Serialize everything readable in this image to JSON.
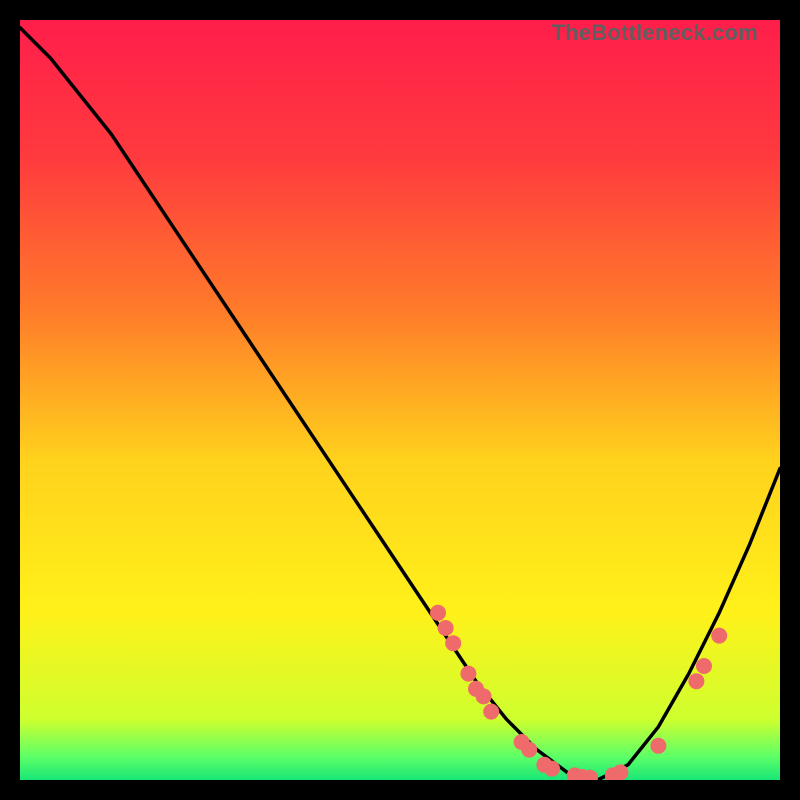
{
  "attribution": "TheBottleneck.com",
  "chart_data": {
    "type": "line",
    "title": "",
    "xlabel": "",
    "ylabel": "",
    "xlim": [
      0,
      100
    ],
    "ylim": [
      0,
      100
    ],
    "gradient_stops": [
      {
        "offset": 0,
        "color": "#ff1e4b"
      },
      {
        "offset": 18,
        "color": "#ff3a3e"
      },
      {
        "offset": 38,
        "color": "#ff7a2a"
      },
      {
        "offset": 58,
        "color": "#ffd21c"
      },
      {
        "offset": 78,
        "color": "#fff11a"
      },
      {
        "offset": 92,
        "color": "#ceff2e"
      },
      {
        "offset": 97,
        "color": "#5bff68"
      },
      {
        "offset": 100,
        "color": "#19e676"
      }
    ],
    "series": [
      {
        "name": "bottleneck-curve",
        "x": [
          0,
          4,
          8,
          12,
          16,
          20,
          24,
          28,
          32,
          36,
          40,
          44,
          48,
          52,
          56,
          60,
          64,
          68,
          72,
          76,
          80,
          84,
          88,
          92,
          96,
          100
        ],
        "y": [
          99,
          95,
          90,
          85,
          79,
          73,
          67,
          61,
          55,
          49,
          43,
          37,
          31,
          25,
          19,
          13,
          8,
          4,
          1,
          0,
          2,
          7,
          14,
          22,
          31,
          41
        ]
      }
    ],
    "markers": {
      "name": "highlighted-gpus",
      "color": "#ef6a6a",
      "radius": 8,
      "points": [
        {
          "x": 55,
          "y": 22
        },
        {
          "x": 56,
          "y": 20
        },
        {
          "x": 57,
          "y": 18
        },
        {
          "x": 59,
          "y": 14
        },
        {
          "x": 60,
          "y": 12
        },
        {
          "x": 61,
          "y": 11
        },
        {
          "x": 62,
          "y": 9
        },
        {
          "x": 66,
          "y": 5
        },
        {
          "x": 67,
          "y": 4
        },
        {
          "x": 69,
          "y": 2
        },
        {
          "x": 70,
          "y": 1.5
        },
        {
          "x": 73,
          "y": 0.6
        },
        {
          "x": 74,
          "y": 0.4
        },
        {
          "x": 75,
          "y": 0.3
        },
        {
          "x": 78,
          "y": 0.6
        },
        {
          "x": 79,
          "y": 1.0
        },
        {
          "x": 84,
          "y": 4.5
        },
        {
          "x": 89,
          "y": 13
        },
        {
          "x": 90,
          "y": 15
        },
        {
          "x": 92,
          "y": 19
        }
      ]
    }
  }
}
